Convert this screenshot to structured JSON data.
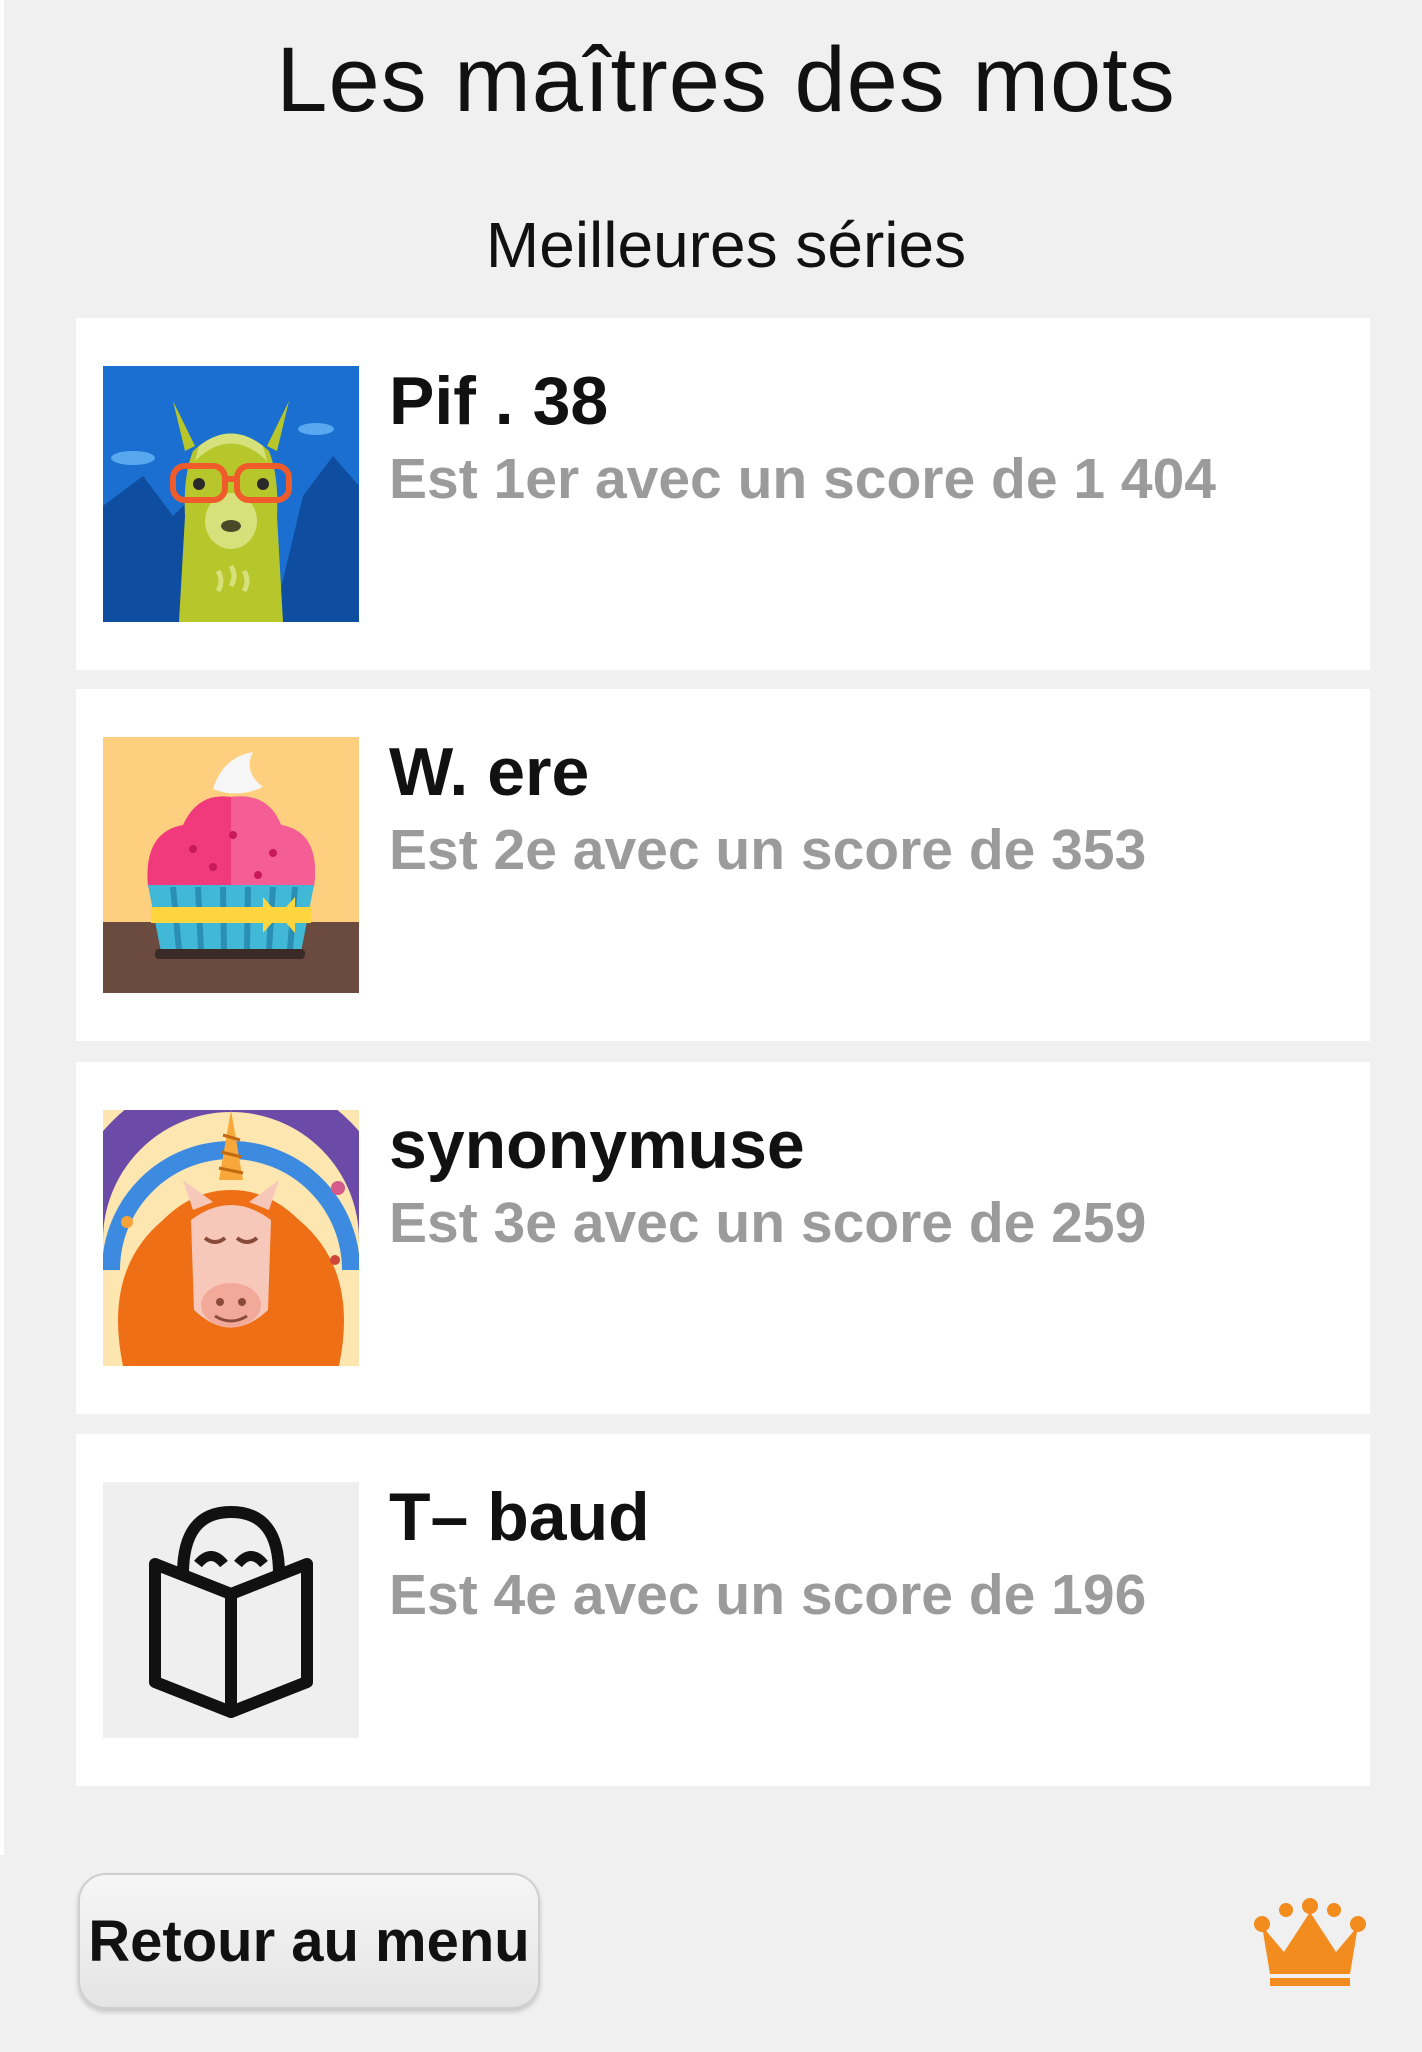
{
  "header": {
    "title": "Les maîtres des mots",
    "subtitle": "Meilleures séries"
  },
  "leaderboard": [
    {
      "name": "Pif . 38",
      "score_text": "Est 1er avec un score de 1 404",
      "rank": 1,
      "score": 1404,
      "avatar_icon": "llama-with-glasses-avatar"
    },
    {
      "name": "W. ere",
      "score_text": "Est 2e avec un score de 353",
      "rank": 2,
      "score": 353,
      "avatar_icon": "cupcake-avatar"
    },
    {
      "name": "synonymuse",
      "score_text": "Est 3e avec un score de 259",
      "rank": 3,
      "score": 259,
      "avatar_icon": "unicorn-avatar"
    },
    {
      "name": "T– baud",
      "score_text": "Est 4e avec un score de 196",
      "rank": 4,
      "score": 196,
      "avatar_icon": "reading-book-avatar"
    }
  ],
  "footer": {
    "back_label": "Retour au menu",
    "crown_icon": "crown-icon"
  },
  "colors": {
    "background": "#f0f0f0",
    "card": "#ffffff",
    "score_text": "#9b9b9b",
    "crown": "#f28c1f"
  }
}
